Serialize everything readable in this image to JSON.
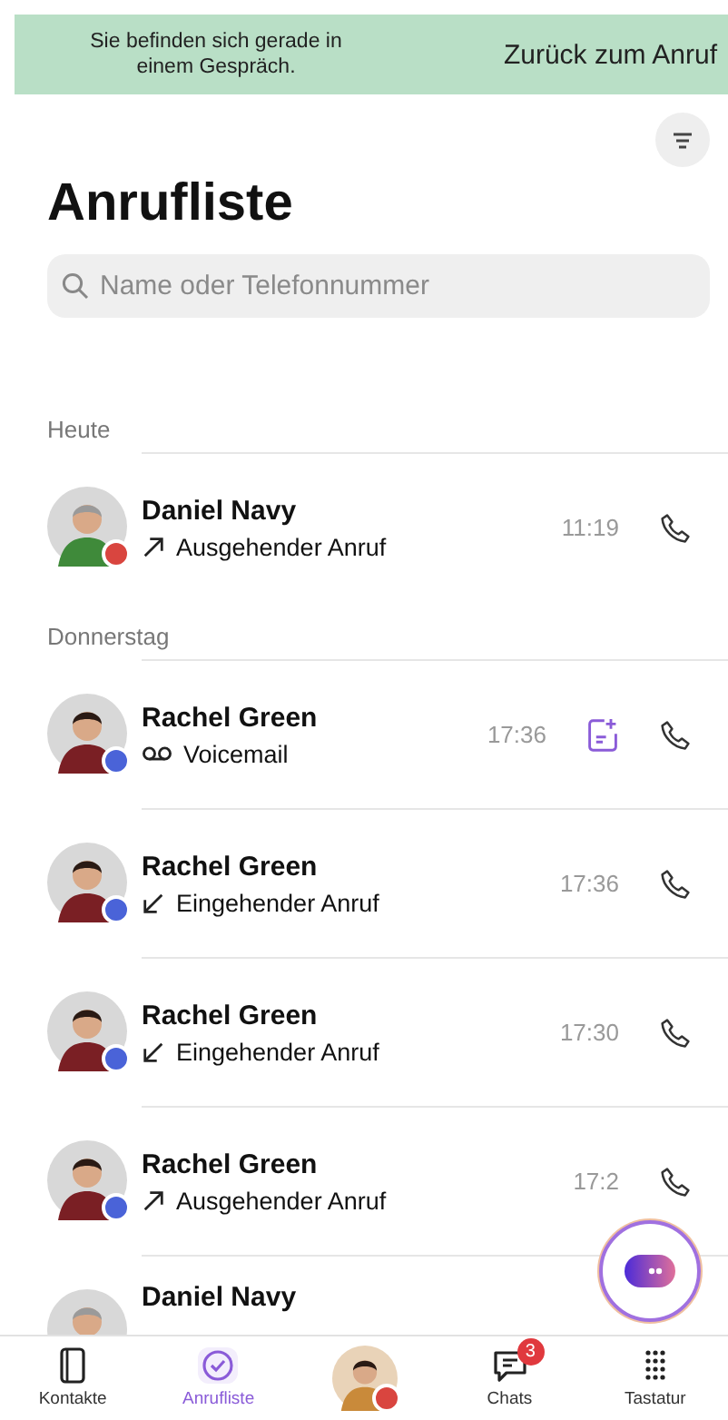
{
  "call_banner": {
    "message": "Sie befinden sich gerade in einem Gespräch.",
    "action": "Zurück zum Anruf"
  },
  "title": "Anrufliste",
  "search": {
    "placeholder": "Name oder Telefonnummer"
  },
  "sections": [
    {
      "label": "Heute",
      "calls": [
        {
          "name": "Daniel Navy",
          "kind": "outgoing",
          "detail": "Ausgehender Anruf",
          "time": "11:19",
          "color": "#d9453f",
          "transcript": false
        }
      ]
    },
    {
      "label": "Donnerstag",
      "calls": [
        {
          "name": "Rachel Green",
          "kind": "voicemail",
          "detail": "Voicemail",
          "time": "17:36",
          "color": "#4a63d8",
          "transcript": true
        },
        {
          "name": "Rachel Green",
          "kind": "incoming",
          "detail": "Eingehender Anruf",
          "time": "17:36",
          "color": "#4a63d8",
          "transcript": false
        },
        {
          "name": "Rachel Green",
          "kind": "incoming",
          "detail": "Eingehender Anruf",
          "time": "17:30",
          "color": "#4a63d8",
          "transcript": false
        },
        {
          "name": "Rachel Green",
          "kind": "outgoing",
          "detail": "Ausgehender Anruf",
          "time": "17:2",
          "color": "#4a63d8",
          "transcript": false
        },
        {
          "name": "Daniel Navy",
          "kind": "partial"
        }
      ]
    }
  ],
  "tabs": [
    {
      "kind": "contacts",
      "label": "Kontakte",
      "selected": false
    },
    {
      "kind": "calls",
      "label": "Anrufliste",
      "selected": true
    },
    {
      "kind": "avatar",
      "color": "#d9453f",
      "selected": false
    },
    {
      "kind": "chats",
      "label": "Chats",
      "badge": "3",
      "selected": false
    },
    {
      "kind": "dialpad",
      "label": "Tastatur",
      "selected": false
    }
  ]
}
